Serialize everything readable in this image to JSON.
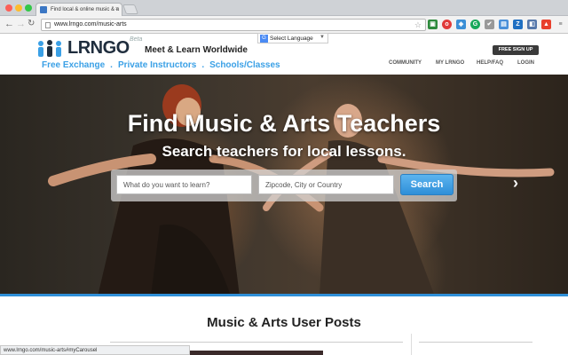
{
  "browser": {
    "tab_title": "Find local & online music & a",
    "url": "www.lrngo.com/music-arts",
    "status_url": "www.lrngo.com/music-arts#myCarousel"
  },
  "header": {
    "logo_text": "LRNGO",
    "logo_beta": "Beta",
    "tagline": "Meet & Learn Worldwide",
    "language_select": "Select Language",
    "subnav": [
      "Free Exchange",
      "Private Instructors",
      "Schools/Classes"
    ],
    "signup_label": "FREE SIGN UP",
    "topnav": [
      "COMMUNITY",
      "MY LRNGO",
      "HELP/FAQ",
      "LOGIN"
    ]
  },
  "hero": {
    "title": "Find Music & Arts Teachers",
    "subtitle": "Search teachers for local lessons.",
    "what_placeholder": "What do you want to learn?",
    "where_placeholder": "Zipcode, City or Country",
    "search_label": "Search",
    "next_icon": "chevron-right-icon"
  },
  "section": {
    "title": "Music & Arts User Posts"
  },
  "colors": {
    "accent": "#3aa0e6",
    "search_button": "#2f8fd8",
    "signup": "#3a3a3a"
  }
}
